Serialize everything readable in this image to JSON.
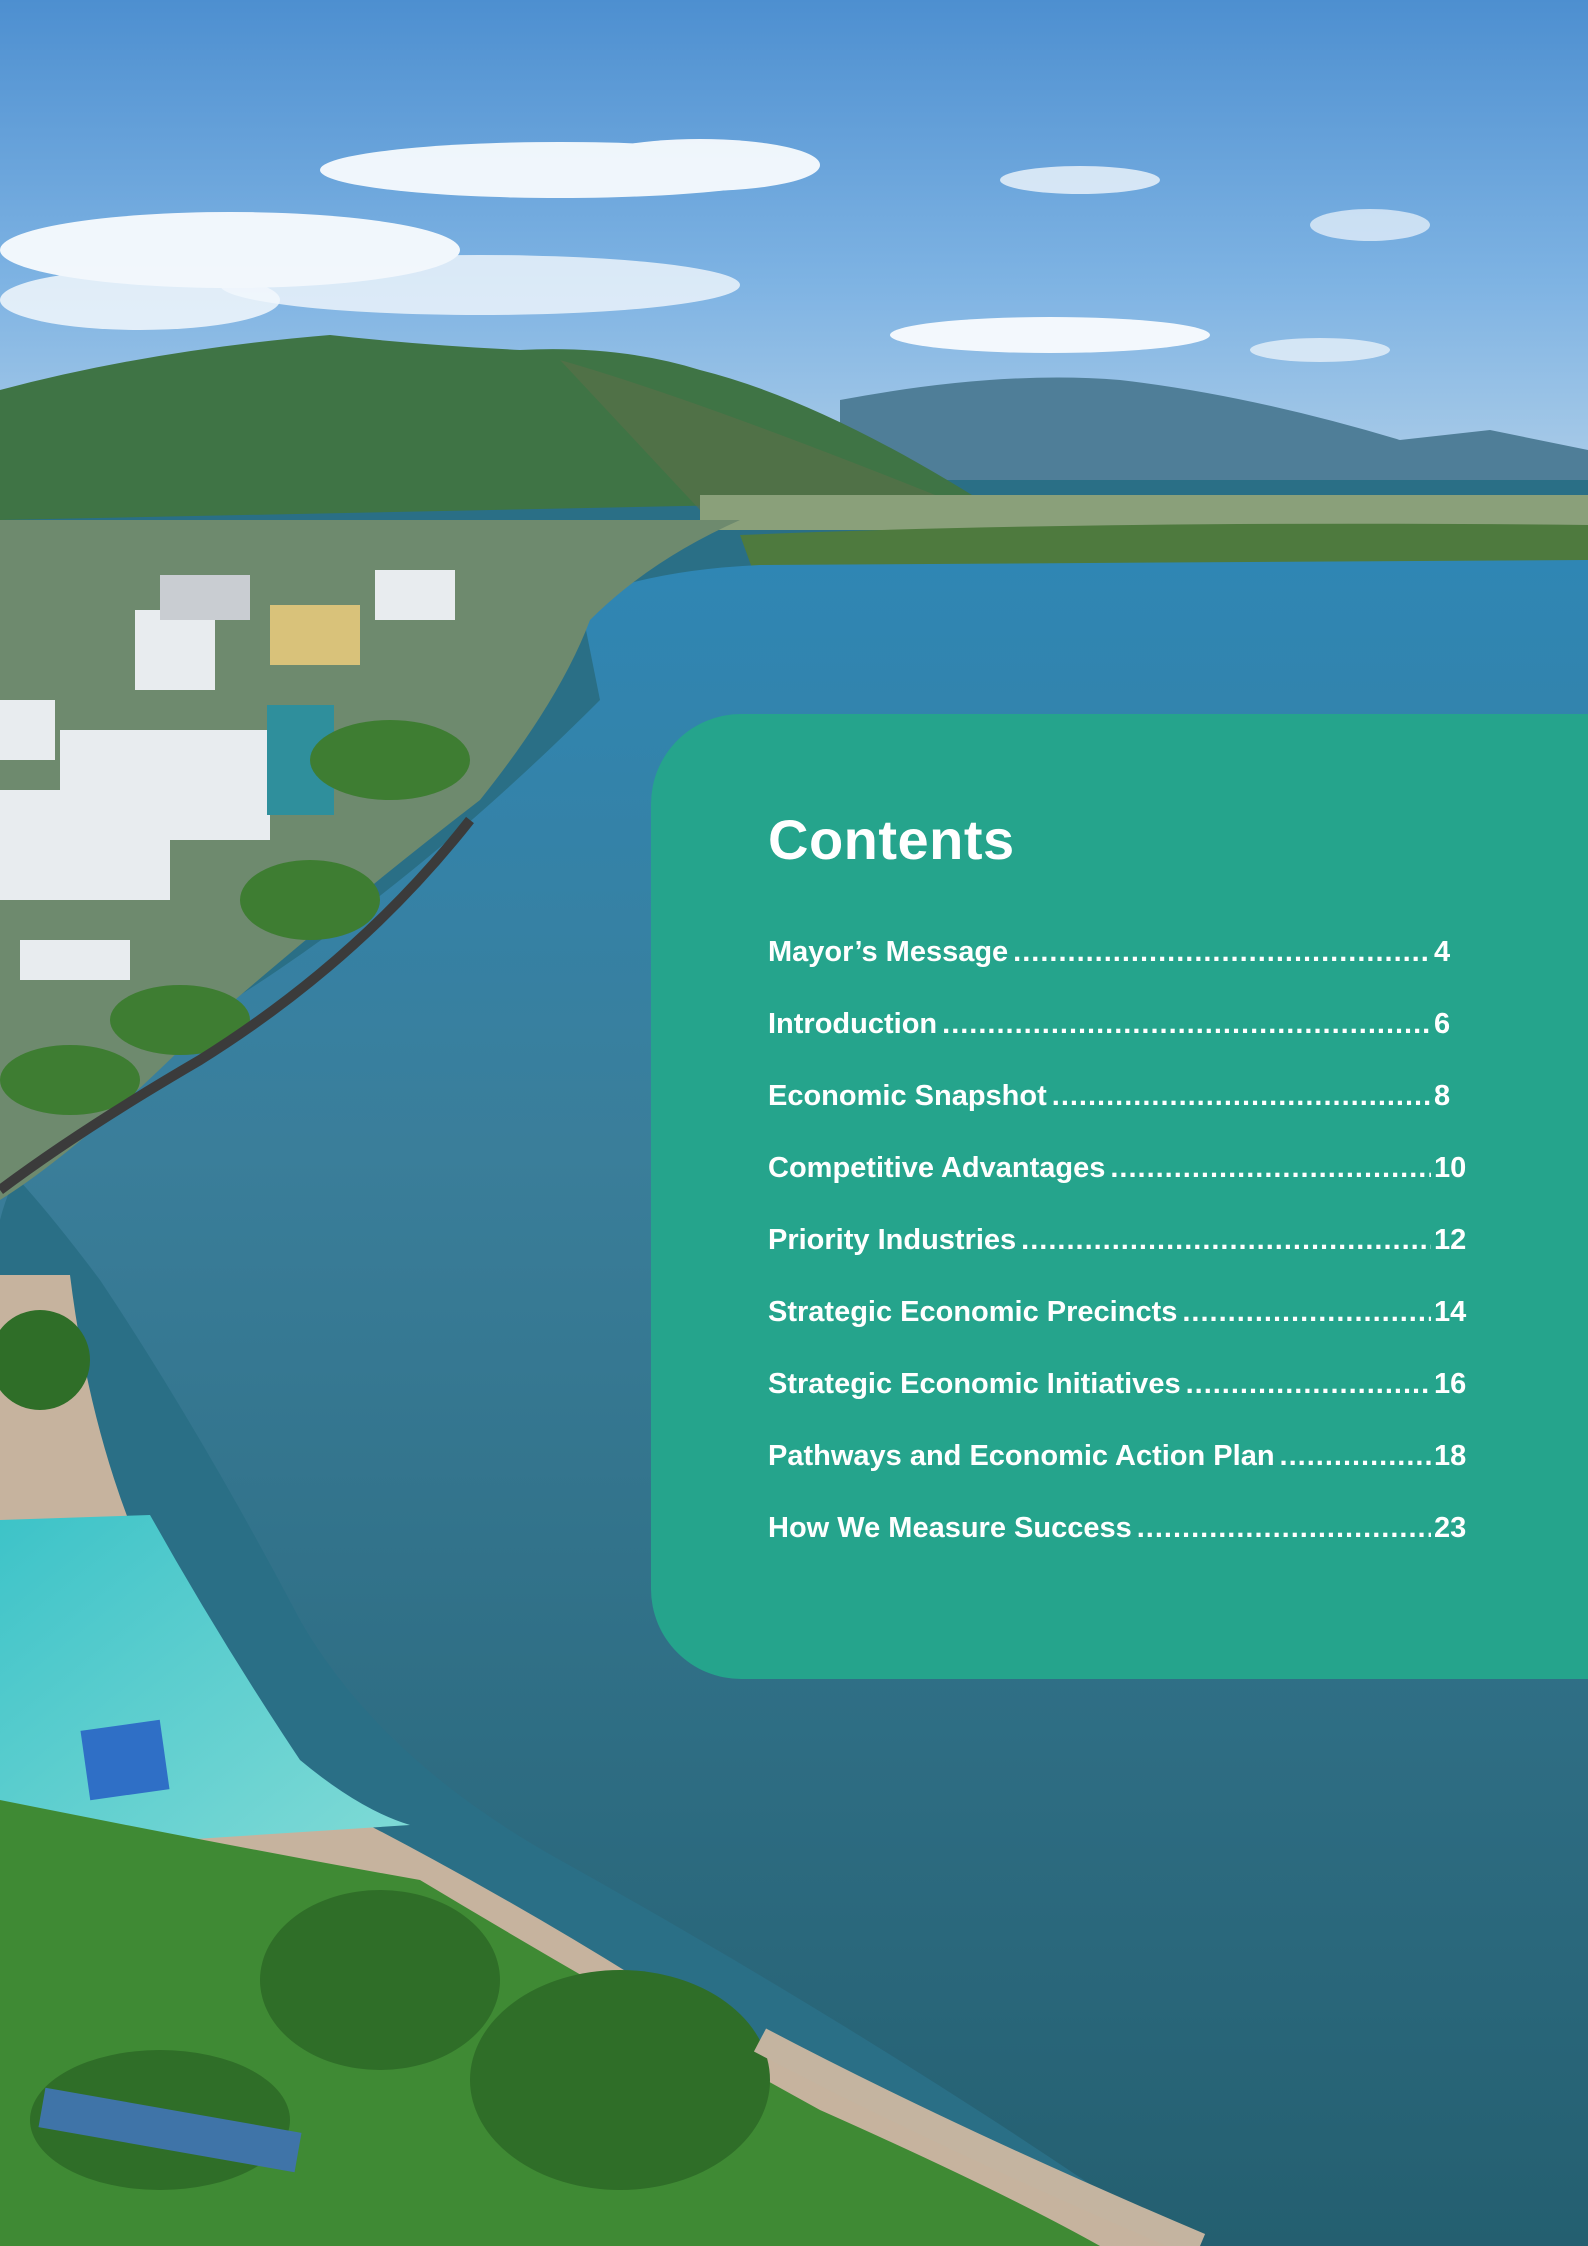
{
  "page": {
    "title": "Contents"
  },
  "contents": {
    "title": "Contents",
    "items": [
      {
        "label": "Mayor’s Message",
        "page": "4"
      },
      {
        "label": "Introduction",
        "page": "6"
      },
      {
        "label": "Economic Snapshot",
        "page": "8"
      },
      {
        "label": "Competitive Advantages",
        "page": "10"
      },
      {
        "label": "Priority Industries",
        "page": "12"
      },
      {
        "label": "Strategic Economic Precincts",
        "page": "14"
      },
      {
        "label": "Strategic Economic Initiatives",
        "page": "16"
      },
      {
        "label": "Pathways and Economic Action Plan",
        "page": "18"
      },
      {
        "label": "How We Measure Success",
        "page": "23"
      }
    ]
  },
  "colors": {
    "panel": "#25a48c",
    "text": "#ffffff",
    "sky": "#5f9fd6",
    "water": "#2a6f86",
    "lagoon": "#5fd0d0"
  }
}
